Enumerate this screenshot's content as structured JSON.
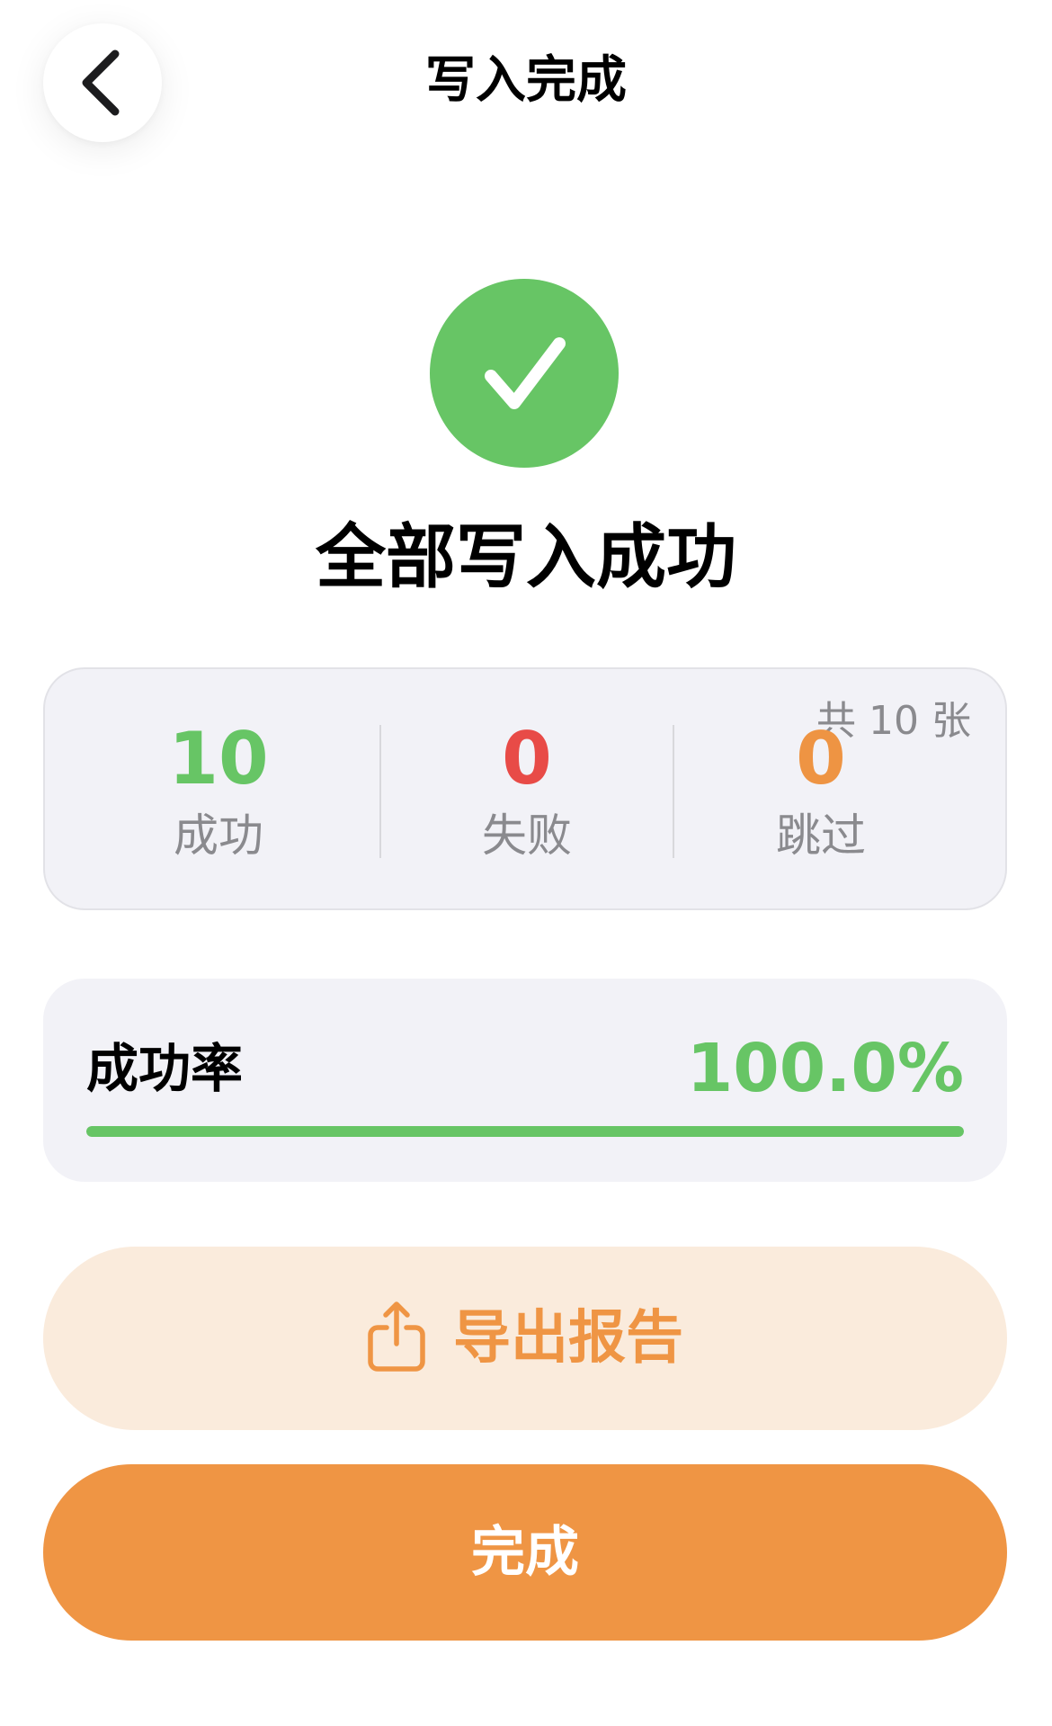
{
  "header": {
    "title": "写入完成",
    "back_icon": "chevron-left-icon"
  },
  "result": {
    "icon": "checkmark-circle-icon",
    "title": "全部写入成功"
  },
  "stats": {
    "total_label": "共 10 张",
    "success": {
      "value": "10",
      "label": "成功"
    },
    "failed": {
      "value": "0",
      "label": "失败"
    },
    "skipped": {
      "value": "0",
      "label": "跳过"
    }
  },
  "rate": {
    "label": "成功率",
    "value_text": "100.0%",
    "percent": 100
  },
  "actions": {
    "export_label": "导出报告",
    "export_icon": "share-icon",
    "done_label": "完成"
  },
  "colors": {
    "success": "#67c565",
    "failed": "#e84b47",
    "skipped": "#ee9443",
    "accent": "#ef9544",
    "export_bg": "#faebdc",
    "card_bg": "#f2f2f7"
  }
}
